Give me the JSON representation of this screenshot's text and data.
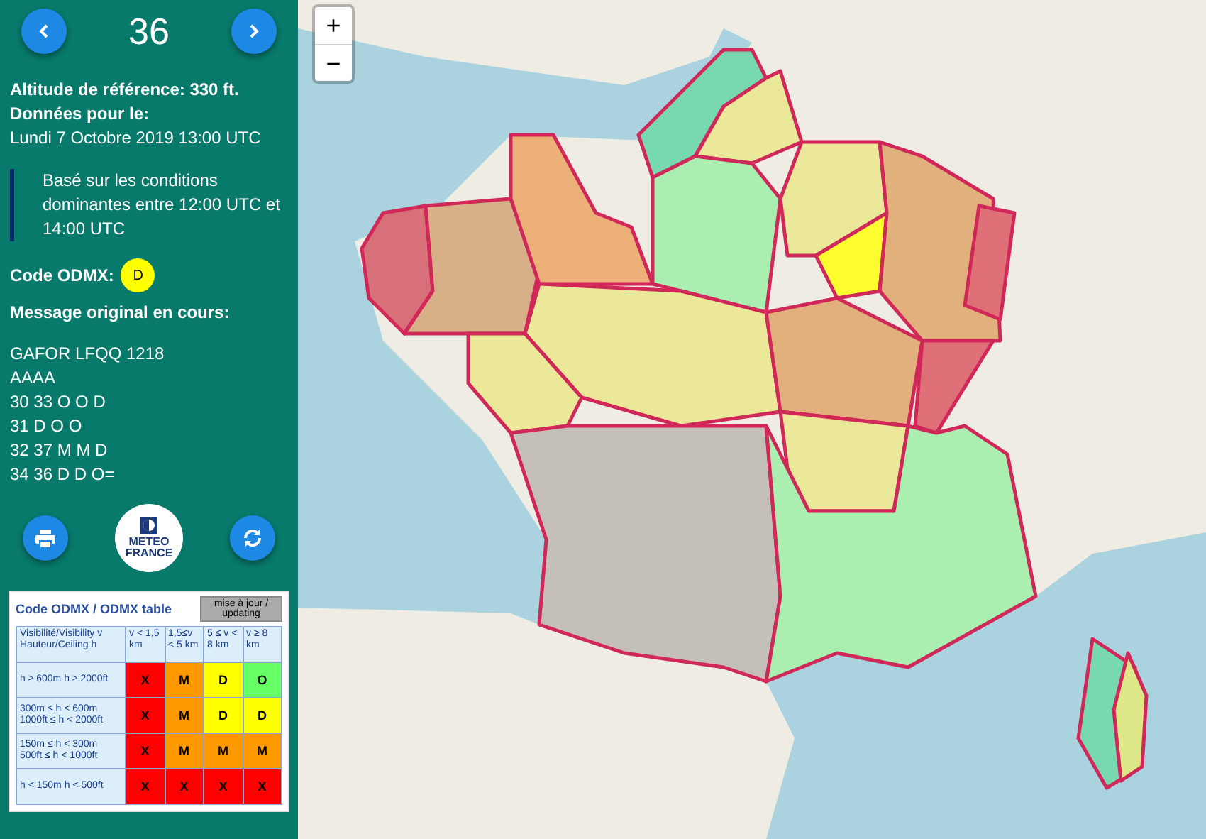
{
  "panel": {
    "counter": "36",
    "altitude": "Altitude de référence: 330 ft.",
    "data_for_label": "Données pour le:",
    "date": "Lundi 7 Octobre 2019 13:00 UTC",
    "note": "Basé sur les conditions dominantes entre 12:00 UTC et 14:00 UTC",
    "code_label": "Code ODMX:",
    "code": {
      "text": "D",
      "color": "#ffff00"
    },
    "message_label": "Message original en cours:",
    "message_lines": [
      "GAFOR LFQQ 1218",
      "AAAA",
      "30 33 O O D",
      "31 D O O",
      "32 37 M M D",
      "34 36 D D O="
    ],
    "logo_text": [
      "METEO",
      "FRANCE"
    ]
  },
  "table": {
    "title": "Code ODMX / ODMX table",
    "update_button": "mise à jour / updating",
    "columns": [
      "Visibilité/Visibility v Hauteur/Ceiling h",
      "v < 1,5 km",
      "1,5≤v < 5 km",
      "5 ≤ v < 8 km",
      "v ≥ 8 km"
    ],
    "rows": [
      {
        "cells": [
          {
            "text": "h ≥ 600m h ≥ 2000ft"
          },
          {
            "text": "X",
            "color": "#ff0000"
          },
          {
            "text": "M",
            "color": "#ff9900"
          },
          {
            "text": "D",
            "color": "#ffff00"
          },
          {
            "text": "O",
            "color": "#66ff66"
          }
        ]
      },
      {
        "cells": [
          {
            "text": "300m ≤ h < 600m 1000ft ≤ h < 2000ft"
          },
          {
            "text": "X",
            "color": "#ff0000"
          },
          {
            "text": "M",
            "color": "#ff9900"
          },
          {
            "text": "D",
            "color": "#ffff00"
          },
          {
            "text": "D",
            "color": "#ffff00"
          }
        ]
      },
      {
        "cells": [
          {
            "text": "150m ≤ h < 300m 500ft ≤ h < 1000ft"
          },
          {
            "text": "X",
            "color": "#ff0000"
          },
          {
            "text": "M",
            "color": "#ff9900"
          },
          {
            "text": "M",
            "color": "#ff9900"
          },
          {
            "text": "M",
            "color": "#ff9900"
          }
        ]
      },
      {
        "cells": [
          {
            "text": "h < 150m h < 500ft"
          },
          {
            "text": "X",
            "color": "#ff0000"
          },
          {
            "text": "X",
            "color": "#ff0000"
          },
          {
            "text": "X",
            "color": "#ff0000"
          },
          {
            "text": "X",
            "color": "#ff0000"
          }
        ]
      }
    ]
  },
  "map": {
    "zoom_in": "+",
    "zoom_out": "−",
    "zones": [
      {
        "color": "#d8707a"
      },
      {
        "color": "#d8b088"
      },
      {
        "color": "#ecb078"
      },
      {
        "color": "#78d8b0"
      },
      {
        "color": "#ece89a"
      },
      {
        "color": "#aaeeb0"
      },
      {
        "color": "#ece89a"
      },
      {
        "color": "#ffff30"
      },
      {
        "color": "#e2b07c"
      },
      {
        "color": "#e07078"
      },
      {
        "color": "#ece89a"
      },
      {
        "color": "#e2b07c"
      },
      {
        "color": "#e07078"
      },
      {
        "color": "#ece89a"
      },
      {
        "color": "#c4c0b8"
      },
      {
        "color": "#ece89a"
      },
      {
        "color": "#aaeeb0"
      },
      {
        "color": "#78d8b0"
      },
      {
        "color": "#dee888"
      }
    ]
  }
}
